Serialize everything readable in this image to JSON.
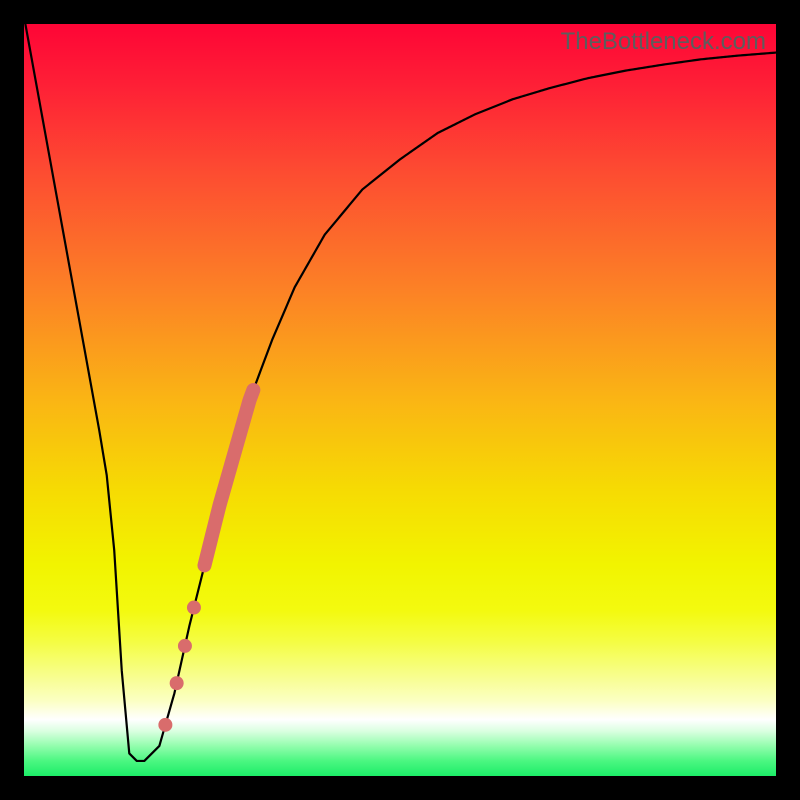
{
  "watermark": "TheBottleneck.com",
  "colors": {
    "frame": "#000000",
    "curve": "#000000",
    "marker": "#d96c6c",
    "gradient_stops": [
      {
        "offset": 0.0,
        "color": "#fe0536"
      },
      {
        "offset": 0.08,
        "color": "#fe1f36"
      },
      {
        "offset": 0.2,
        "color": "#fd4d31"
      },
      {
        "offset": 0.35,
        "color": "#fc8026"
      },
      {
        "offset": 0.5,
        "color": "#fab514"
      },
      {
        "offset": 0.62,
        "color": "#f6db03"
      },
      {
        "offset": 0.72,
        "color": "#f2f400"
      },
      {
        "offset": 0.78,
        "color": "#f3fa0f"
      },
      {
        "offset": 0.82,
        "color": "#f4fd41"
      },
      {
        "offset": 0.86,
        "color": "#f7fe82"
      },
      {
        "offset": 0.9,
        "color": "#fbffc3"
      },
      {
        "offset": 0.925,
        "color": "#ffffff"
      },
      {
        "offset": 0.94,
        "color": "#dbffe1"
      },
      {
        "offset": 0.96,
        "color": "#93fdad"
      },
      {
        "offset": 0.98,
        "color": "#4bf781"
      },
      {
        "offset": 1.0,
        "color": "#1ced68"
      }
    ]
  },
  "chart_data": {
    "type": "line",
    "title": "",
    "xlabel": "",
    "ylabel": "",
    "xlim": [
      0,
      100
    ],
    "ylim": [
      0,
      100
    ],
    "series": [
      {
        "name": "bottleneck-curve",
        "x": [
          0,
          2,
          4,
          6,
          8,
          10,
          11,
          12,
          13,
          14,
          15,
          16,
          18,
          20,
          22,
          24,
          26,
          28,
          30,
          33,
          36,
          40,
          45,
          50,
          55,
          60,
          65,
          70,
          75,
          80,
          85,
          90,
          95,
          100
        ],
        "y": [
          101,
          90,
          79,
          68,
          57,
          46,
          40,
          30,
          14,
          3,
          2,
          2,
          4,
          11,
          20,
          28,
          36,
          43,
          50,
          58,
          65,
          72,
          78,
          82,
          85.5,
          88,
          90,
          91.5,
          92.8,
          93.8,
          94.6,
          95.3,
          95.8,
          96.2
        ]
      }
    ],
    "markers": {
      "thick_segment": {
        "x_start": 24.0,
        "x_end": 30.5,
        "note": "thick salmon stroke along curve"
      },
      "dots": [
        {
          "x": 22.6,
          "y_on_curve": true
        },
        {
          "x": 21.4,
          "y_on_curve": true
        },
        {
          "x": 20.3,
          "y_on_curve": true
        },
        {
          "x": 18.8,
          "y_on_curve": true
        }
      ]
    }
  }
}
